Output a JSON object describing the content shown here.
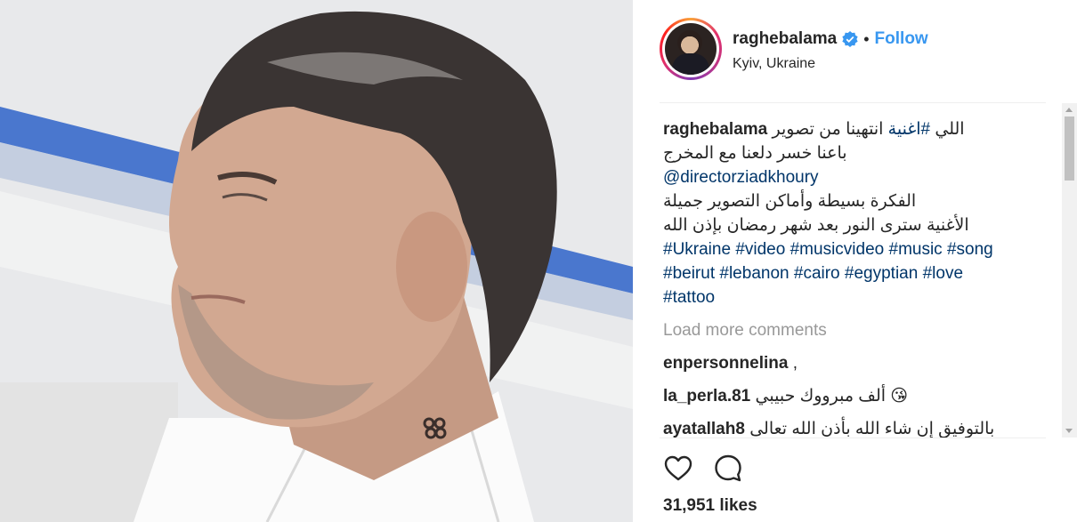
{
  "post": {
    "photo_alt": "",
    "header": {
      "username": "raghebalama",
      "separator": "•",
      "follow_label": "Follow",
      "location": "Kyiv, Ukraine"
    },
    "caption": {
      "username": "raghebalama",
      "line1_text": "انتهينا من تصوير",
      "line1_tag": "#اغنية",
      "line1_end": "اللي",
      "line2": "باعنا خسر دلعنا مع المخرج",
      "mention": "@directorziadkhoury",
      "line3": "الفكرة بسيطة وأماكن التصوير جميلة",
      "line4": "الأغنية سترى النور بعد شهر رمضان بإذن الله",
      "hashtags": [
        "#Ukraine",
        "#video",
        "#musicvideo",
        "#music",
        "#song",
        "#beirut",
        "#lebanon",
        "#cairo",
        "#egyptian",
        "#love",
        "#tattoo"
      ]
    },
    "load_more_label": "Load more comments",
    "comments": [
      {
        "user": "enpersonnelina",
        "text": ","
      },
      {
        "user": "la_perla.81",
        "text": "ألف مبرووك حبيبي 😘"
      },
      {
        "user": "ayatallah8",
        "text": "بالتوفيق إن شاء الله بأذن الله تعالى"
      }
    ],
    "likes_label": "31,951 likes"
  },
  "icons": {
    "verified": "verified-badge-icon",
    "like": "heart-icon",
    "comment": "comment-bubble-icon"
  },
  "colors": {
    "link": "#3897f0",
    "hashtag": "#003569",
    "muted": "#999999",
    "verified": "#3897f0"
  }
}
